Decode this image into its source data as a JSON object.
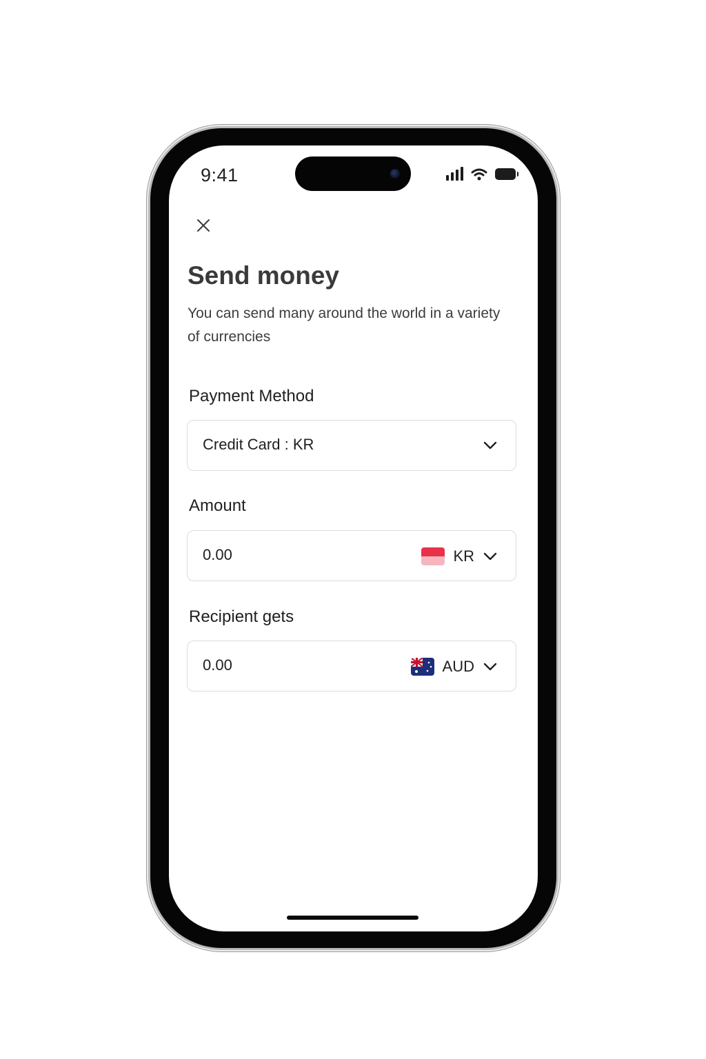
{
  "status_bar": {
    "time": "9:41"
  },
  "header": {
    "close_icon": "close-icon",
    "title": "Send money",
    "subtitle": "You can send many around the world in a variety of currencies"
  },
  "payment_method": {
    "label": "Payment Method",
    "selected": "Credit Card : KR"
  },
  "amount": {
    "label": "Amount",
    "value": "0.00",
    "currency": "KR",
    "flag_icon": "kr-flag-icon"
  },
  "recipient": {
    "label": "Recipient gets",
    "value": "0.00",
    "currency": "AUD",
    "flag_icon": "aud-flag-icon"
  },
  "colors": {
    "text_primary": "#1f1f1f",
    "title": "#3a3a3a",
    "field_border": "#dcdcdc"
  }
}
